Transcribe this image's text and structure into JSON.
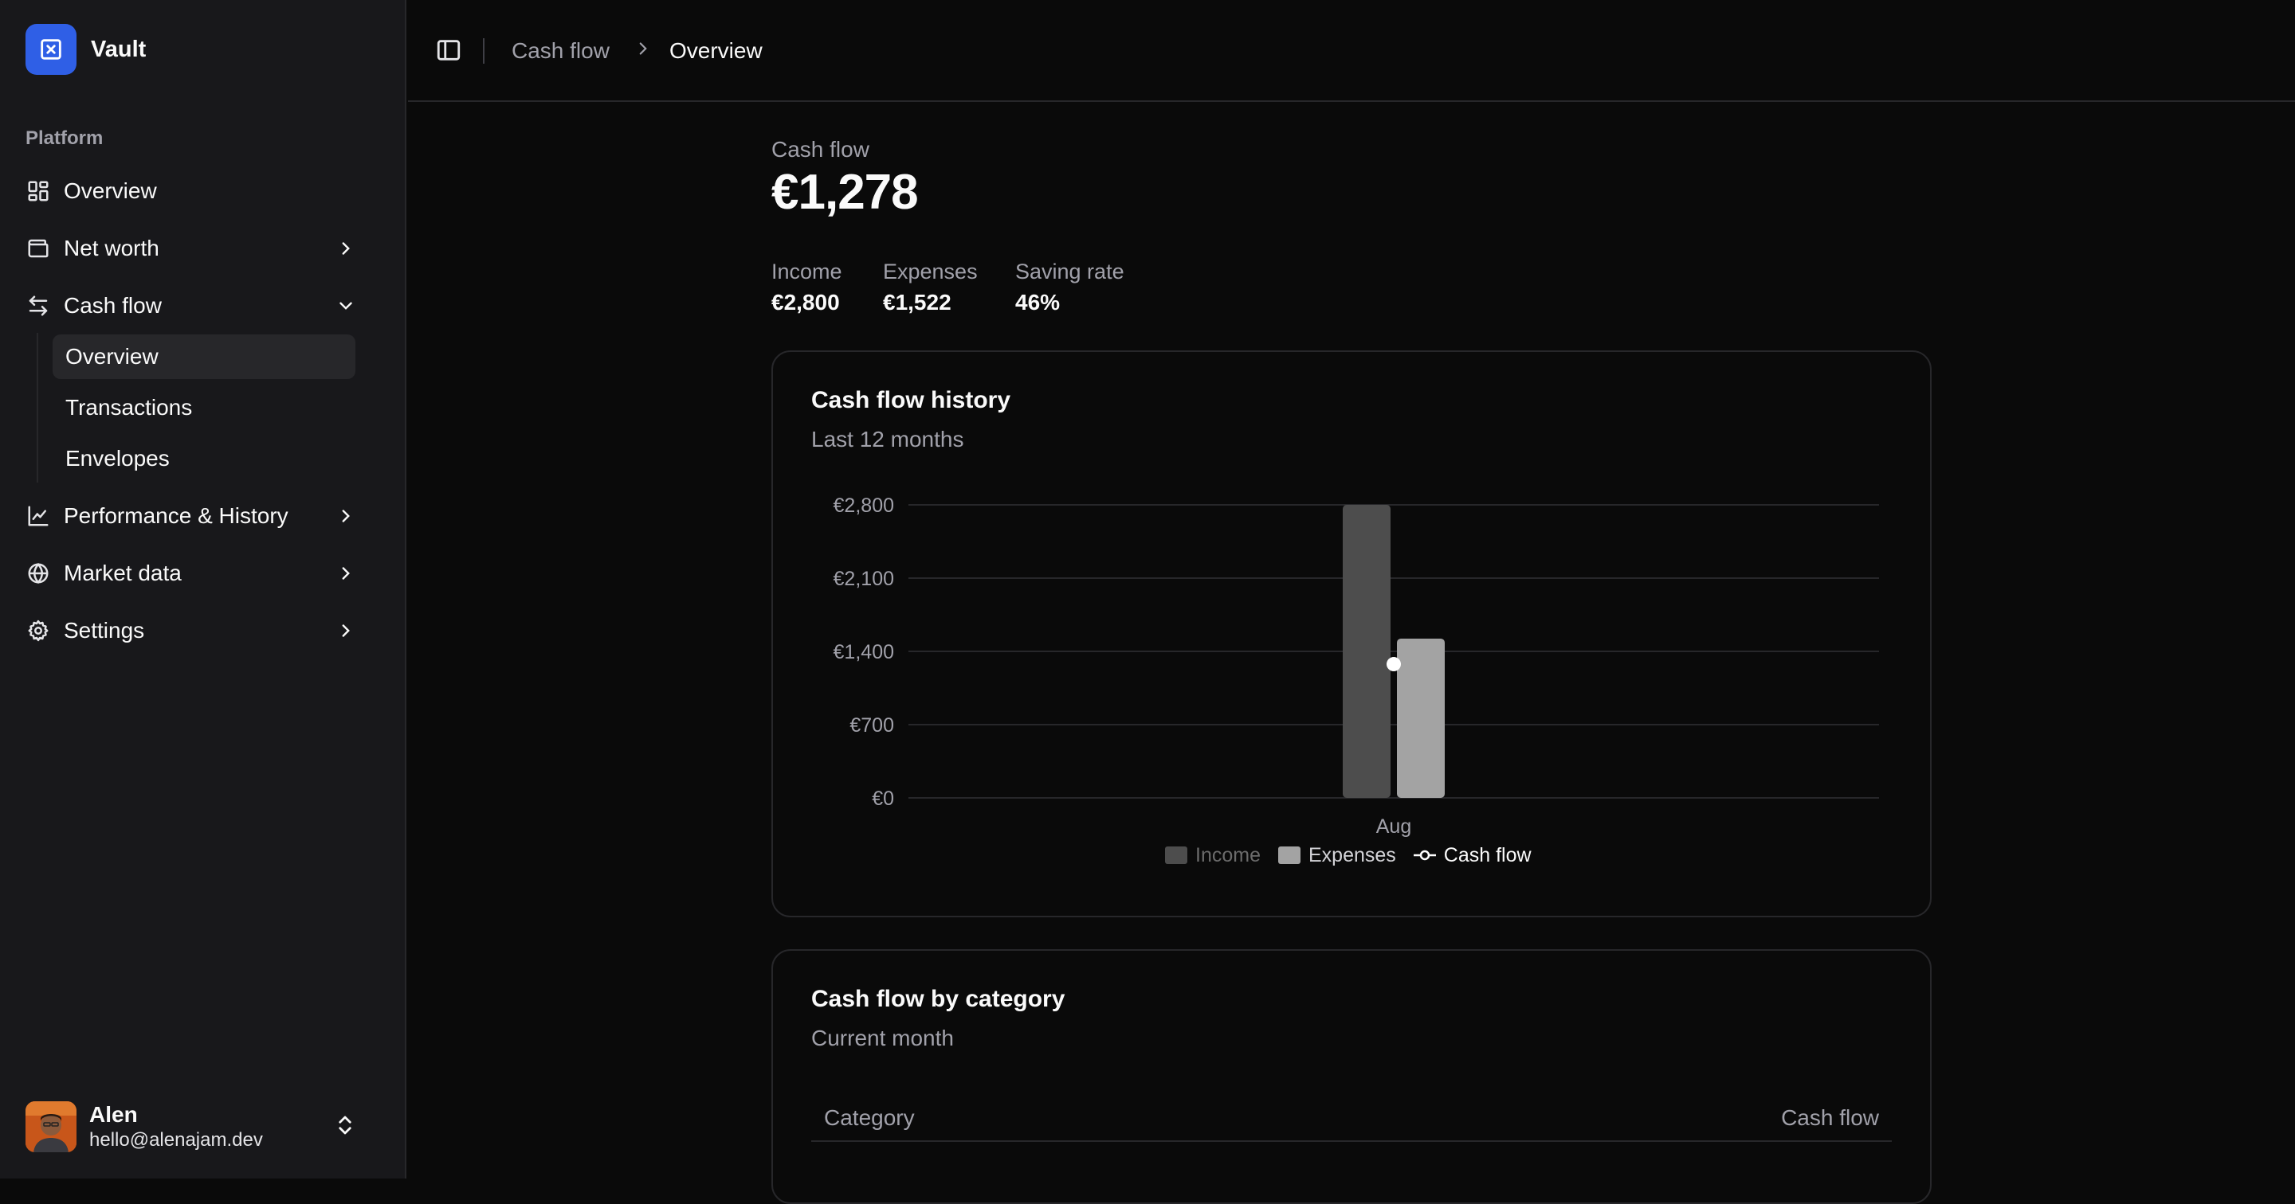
{
  "brand": {
    "name": "Vault",
    "icon": "close-square-icon",
    "color": "#2f5fe6"
  },
  "sidebar": {
    "group_label": "Platform",
    "items": [
      {
        "label": "Overview",
        "icon": "layout-grid-icon"
      },
      {
        "label": "Net worth",
        "icon": "wallet-icon",
        "chevron": "right"
      },
      {
        "label": "Cash flow",
        "icon": "arrows-left-right-icon",
        "chevron": "down"
      },
      {
        "label": "Performance & History",
        "icon": "line-chart-icon",
        "chevron": "right"
      },
      {
        "label": "Market data",
        "icon": "globe-icon",
        "chevron": "right"
      },
      {
        "label": "Settings",
        "icon": "gear-icon",
        "chevron": "right"
      }
    ],
    "subitems": [
      {
        "label": "Overview",
        "active": true
      },
      {
        "label": "Transactions"
      },
      {
        "label": "Envelopes"
      }
    ]
  },
  "user": {
    "name": "Alen",
    "email": "hello@alenajam.dev"
  },
  "breadcrumb": {
    "parent": "Cash flow",
    "current": "Overview"
  },
  "summary": {
    "label": "Cash flow",
    "value": "€1,278",
    "stats": [
      {
        "label": "Income",
        "value": "€2,800"
      },
      {
        "label": "Expenses",
        "value": "€1,522"
      },
      {
        "label": "Saving rate",
        "value": "46%"
      }
    ]
  },
  "history_card": {
    "title": "Cash flow history",
    "subtitle": "Last 12 months"
  },
  "category_card": {
    "title": "Cash flow by category",
    "subtitle": "Current month",
    "columns": [
      "Category",
      "Cash flow"
    ]
  },
  "chart_data": {
    "type": "bar",
    "title": "Cash flow history",
    "subtitle": "Last 12 months",
    "categories": [
      "Aug"
    ],
    "series": [
      {
        "name": "Income",
        "type": "bar",
        "color": "#4d4d4d",
        "values": [
          2800
        ]
      },
      {
        "name": "Expenses",
        "type": "bar",
        "color": "#a3a3a3",
        "values": [
          1522
        ]
      },
      {
        "name": "Cash flow",
        "type": "line",
        "color": "#ffffff",
        "values": [
          1278
        ]
      }
    ],
    "yticks": [
      "€0",
      "€700",
      "€1,400",
      "€2,100",
      "€2,800"
    ],
    "ytick_values": [
      0,
      700,
      1400,
      2100,
      2800
    ],
    "ylim": [
      0,
      2800
    ],
    "grid": true,
    "legend": "bottom"
  }
}
